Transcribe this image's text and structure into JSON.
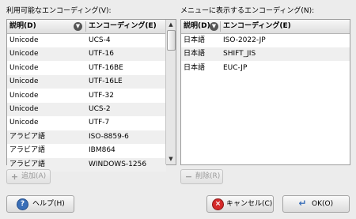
{
  "available": {
    "label": "利用可能なエンコーディング(V):",
    "columns": [
      "説明(D)",
      "エンコーディング(E)"
    ],
    "rows": [
      [
        "Unicode",
        "UCS-4"
      ],
      [
        "Unicode",
        "UTF-16"
      ],
      [
        "Unicode",
        "UTF-16BE"
      ],
      [
        "Unicode",
        "UTF-16LE"
      ],
      [
        "Unicode",
        "UTF-32"
      ],
      [
        "Unicode",
        "UCS-2"
      ],
      [
        "Unicode",
        "UTF-7"
      ],
      [
        "アラビア語",
        "ISO-8859-6"
      ],
      [
        "アラビア語",
        "IBM864"
      ],
      [
        "アラビア語",
        "WINDOWS-1256"
      ]
    ],
    "add_button": "追加(A)"
  },
  "shown": {
    "label": "メニューに表示するエンコーディング(N):",
    "columns": [
      "説明(D)",
      "エンコーディング(E)"
    ],
    "rows": [
      [
        "日本語",
        "ISO-2022-JP"
      ],
      [
        "日本語",
        "SHIFT_JIS"
      ],
      [
        "日本語",
        "EUC-JP"
      ]
    ],
    "remove_button": "削除(R)"
  },
  "footer": {
    "help_button": "ヘルプ(H)",
    "cancel_button": "キャンセル(C)",
    "ok_button": "OK(O)"
  }
}
